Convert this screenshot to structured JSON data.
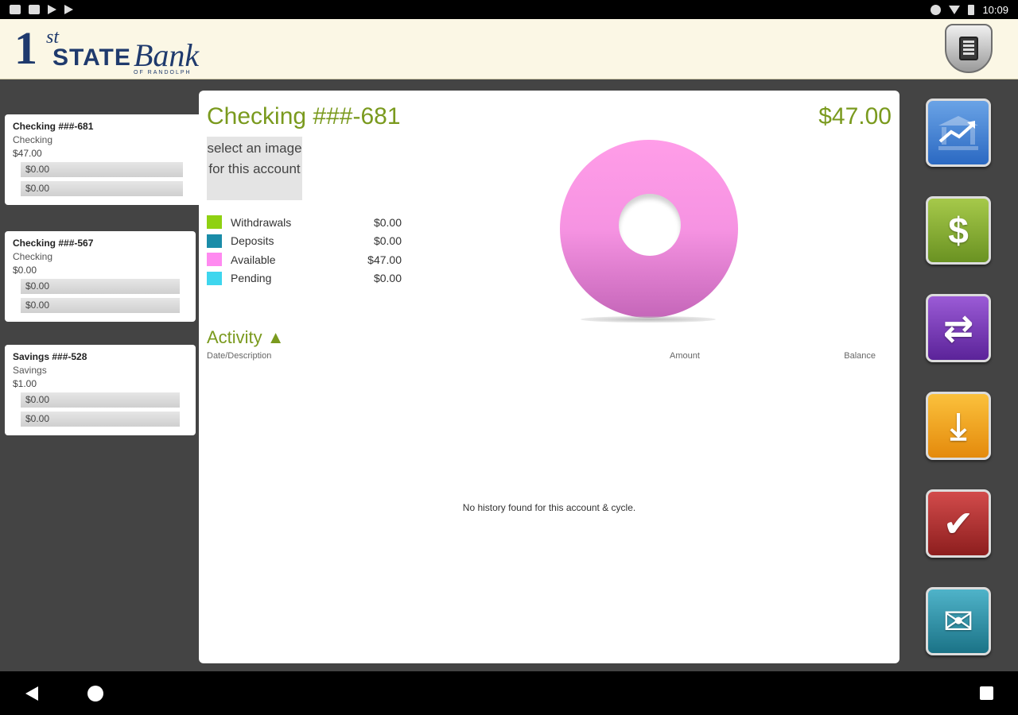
{
  "status_bar": {
    "time": "10:09"
  },
  "header": {
    "logo": {
      "one": "1",
      "st": "st",
      "state": "STATE",
      "bank": "Bank",
      "sub": "OF RANDOLPH"
    },
    "calculator_icon": "calculator-icon"
  },
  "accounts": [
    {
      "name": "Checking ###-681",
      "type": "Checking",
      "balance": "$47.00",
      "bar1": "$0.00",
      "bar2": "$0.00"
    },
    {
      "name": "Checking ###-567",
      "type": "Checking",
      "balance": "$0.00",
      "bar1": "$0.00",
      "bar2": "$0.00"
    },
    {
      "name": "Savings ###-528",
      "type": "Savings",
      "balance": "$1.00",
      "bar1": "$0.00",
      "bar2": "$0.00"
    }
  ],
  "detail": {
    "title": "Checking ###-681",
    "total": "$47.00",
    "image_select": "select an image for this account",
    "legend": [
      {
        "label": "Withdrawals",
        "value": "$0.00",
        "color": "#8fd112"
      },
      {
        "label": "Deposits",
        "value": "$0.00",
        "color": "#1a8ca8"
      },
      {
        "label": "Available",
        "value": "$47.00",
        "color": "#ff8af0"
      },
      {
        "label": "Pending",
        "value": "$0.00",
        "color": "#3ed6ee"
      }
    ],
    "activity": {
      "title": "Activity ▲",
      "col_date": "Date/Description",
      "col_amount": "Amount",
      "col_balance": "Balance",
      "empty_message": "No history found for this account & cycle."
    }
  },
  "actions": [
    {
      "icon": "bank-chart-icon"
    },
    {
      "icon": "dollar-icon",
      "glyph": "$"
    },
    {
      "icon": "transfer-icon",
      "glyph": "⇄"
    },
    {
      "icon": "deposit-download-icon",
      "glyph": "⤓"
    },
    {
      "icon": "checkmark-icon",
      "glyph": "✔"
    },
    {
      "icon": "contact-mail-icon",
      "glyph": "✉"
    }
  ],
  "colors": {
    "accent_green": "#7a9a1e",
    "brand_navy": "#1f3a6d"
  }
}
